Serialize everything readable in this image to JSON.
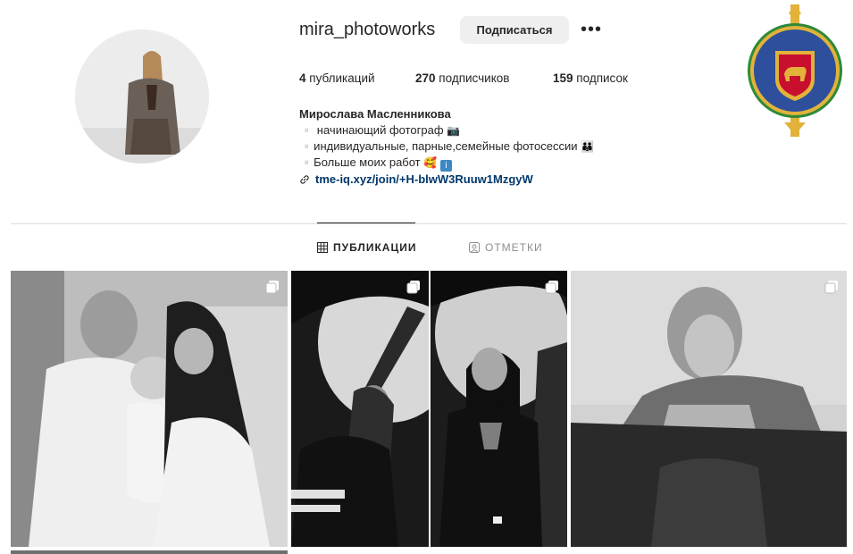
{
  "profile": {
    "username": "mira_photoworks",
    "follow_label": "Подписаться",
    "more_label": "•••",
    "stats": {
      "posts_count": "4",
      "posts_label": "публикаций",
      "followers_count": "270",
      "followers_label": "подписчиков",
      "following_count": "159",
      "following_label": "подписок"
    },
    "full_name": "Мирослава Масленникова",
    "bio_lines": [
      "▫️ начинающий фотограф",
      "▫️индивидуальные, парные,семейные фотосессии",
      "▫️Больше моих работ"
    ],
    "link": "tme-iq.xyz/join/+H-blwW3Ruuw1MzgyW"
  },
  "tabs": [
    {
      "label": "ПУБЛИКАЦИИ",
      "icon": "grid-icon",
      "active": true
    },
    {
      "label": "ОТМЕТКИ",
      "icon": "tagged-icon",
      "active": false
    }
  ],
  "posts": [
    {
      "subject": "family-with-baby",
      "icon": "carousel-icon"
    },
    {
      "subject": "woman-pose-studio",
      "icon": "carousel-icon"
    },
    {
      "subject": "woman-portrait-arm-raised",
      "icon": "carousel-icon"
    },
    {
      "subject": "woman-leaning-on-chair",
      "icon": "carousel-icon"
    }
  ],
  "colors": {
    "link": "#00376b",
    "button_bg": "#efefef",
    "divider": "#dbdbdb",
    "muted_text": "#8e8e8e",
    "emblem_blue": "#2e4f9c",
    "emblem_red": "#c8102e",
    "emblem_gold": "#e2b23a",
    "emblem_green": "#2c8a3a"
  }
}
